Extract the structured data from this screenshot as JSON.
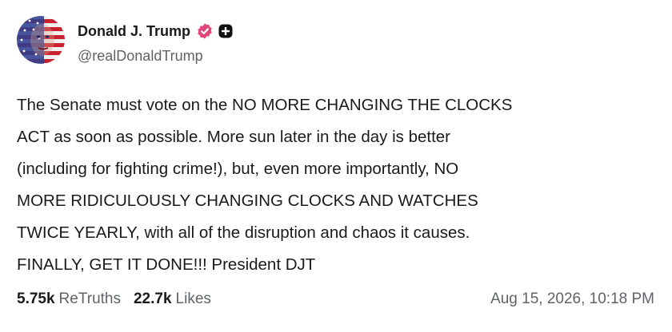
{
  "author": {
    "display_name": "Donald J. Trump",
    "handle": "@realDonaldTrump",
    "verified_badge_icon": "verified-badge-icon",
    "verified_badge_color": "#e0457b",
    "extra_badge_icon": "plus-badge-icon"
  },
  "post": {
    "lines": [
      "The Senate must vote on the NO MORE CHANGING THE CLOCKS",
      "ACT as soon as possible. More sun later in the day is better",
      "(including for fighting crime!), but, even more importantly, NO",
      "MORE RIDICULOUSLY CHANGING CLOCKS AND WATCHES",
      "TWICE YEARLY, with all of the disruption and chaos it causes.",
      "FINALLY, GET IT DONE!!! President DJT"
    ]
  },
  "stats": {
    "retruths_count": "5.75k",
    "retruths_label": "ReTruths",
    "likes_count": "22.7k",
    "likes_label": "Likes"
  },
  "timestamp": "Aug 15, 2026, 10:18 PM"
}
